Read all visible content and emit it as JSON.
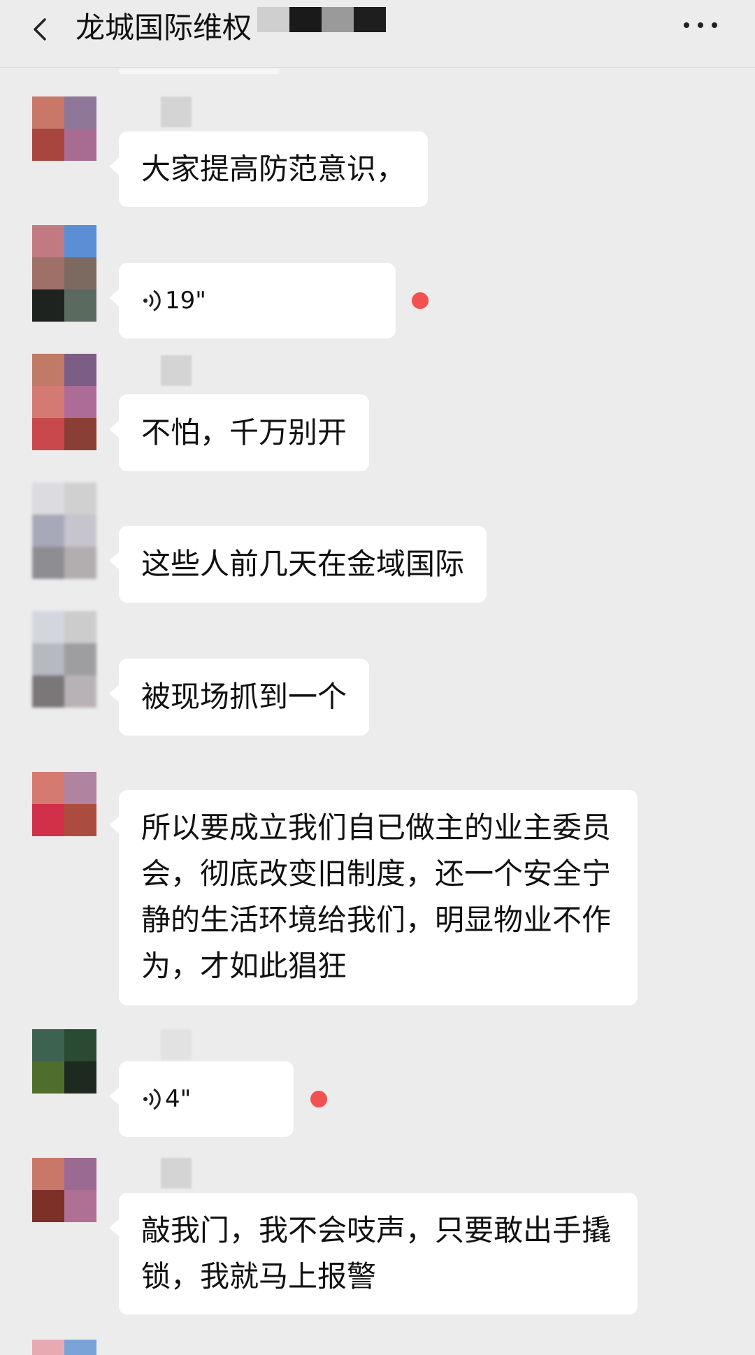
{
  "header": {
    "title": "龙城国际维权",
    "back_icon": "chevron-left-icon",
    "more_icon": "more-dots-icon",
    "title_mosaic_colors": [
      "#cfcfcf",
      "#1a1a1a",
      "#9a9a9a",
      "#1e1e1e"
    ]
  },
  "messages": [
    {
      "type": "text",
      "text": "大家提高防范意识，",
      "avatar": [
        "#c97868",
        "#8e7798",
        "#a8463e",
        "#a86c92"
      ]
    },
    {
      "type": "voice",
      "duration": "19\"",
      "unread": true,
      "avatar": [
        "#c27a82",
        "#5a8fd6",
        "#9e7068",
        "#7c6a60",
        "#1e2320",
        "#5b6a5e"
      ]
    },
    {
      "type": "text",
      "text": "不怕，千万别开",
      "avatar": [
        "#c07a66",
        "#7b5d86",
        "#d57a72",
        "#ad6c98",
        "#c8484c",
        "#8b3e36"
      ]
    },
    {
      "type": "text",
      "text": "这些人前几天在金域国际",
      "avatar": [
        "#dcdce0",
        "#d0d0d0",
        "#a7a8b8",
        "#c6c4cc",
        "#8e8e92",
        "#b2aeb0"
      ]
    },
    {
      "type": "text",
      "text": "被现场抓到一个",
      "avatar": [
        "#d4d6de",
        "#cccccc",
        "#b6b8c2",
        "#9e9ea0",
        "#7b7779",
        "#b8b2b6"
      ]
    },
    {
      "type": "text",
      "text": "所以要成立我们自已做主的业主委员会，彻底改变旧制度，还一个安全宁静的生活环境给我们，明显物业不作为，才如此猖狂",
      "avatar": [
        "#d67a70",
        "#b083a0",
        "#d2304a",
        "#ac4c3e"
      ]
    },
    {
      "type": "voice",
      "duration": "4\"",
      "unread": true,
      "avatar": [
        "#3e6250",
        "#2a4a34",
        "#4f6e2e",
        "#1e2a20"
      ]
    },
    {
      "type": "text",
      "text": "敲我门，我不会吱声，只要敢出手撬锁，我就马上报警",
      "avatar": [
        "#c97868",
        "#9b6a93",
        "#7c3028",
        "#b07096"
      ]
    }
  ]
}
